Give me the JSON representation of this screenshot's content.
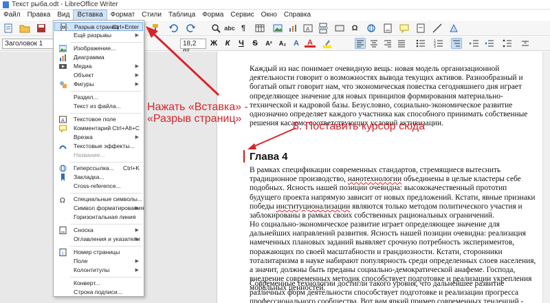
{
  "window": {
    "title": "Текст рыба.odt - LibreOffice Writer"
  },
  "menubar": [
    "Файл",
    "Правка",
    "Вид",
    "Вставка",
    "Формат",
    "Стили",
    "Таблица",
    "Форма",
    "Сервис",
    "Окно",
    "Справка"
  ],
  "toolbar": {
    "paragraph_style": "Заголовок 1",
    "font_size": "18,2 пт"
  },
  "insert_menu": {
    "items": [
      {
        "label": "Разрыв страниц",
        "shortcut": "Ctrl+Enter",
        "highlighted": true,
        "icon": "page-break-icon"
      },
      {
        "label": "Ещё разрывы",
        "submenu": true
      },
      {
        "label": "Изображение...",
        "icon": "image-icon"
      },
      {
        "label": "Диаграмма",
        "icon": "chart-icon"
      },
      {
        "label": "Медиа",
        "submenu": true,
        "icon": "media-icon"
      },
      {
        "label": "Объект",
        "submenu": true
      },
      {
        "label": "Фигуры",
        "submenu": true,
        "icon": "shapes-icon"
      },
      {
        "label": "Раздел..."
      },
      {
        "label": "Текст из файла..."
      },
      {
        "label": "Текстовое поле",
        "icon": "text-box-icon"
      },
      {
        "label": "Комментарий",
        "shortcut": "Ctrl+Alt+C",
        "icon": "comment-icon"
      },
      {
        "label": "Врезка",
        "submenu": true
      },
      {
        "label": "Текстовые эффекты...",
        "icon": "fontwork-icon"
      },
      {
        "label": "Название...",
        "disabled": true
      },
      {
        "label": "Гиперссылка...",
        "shortcut": "Ctrl+K",
        "icon": "hyperlink-icon"
      },
      {
        "label": "Закладка...",
        "icon": "bookmark-icon"
      },
      {
        "label": "Cross-reference..."
      },
      {
        "label": "Специальные символы...",
        "icon": "special-char-icon"
      },
      {
        "label": "Символ форматирования",
        "submenu": true
      },
      {
        "label": "Горизонтальная линия"
      },
      {
        "label": "Сноска",
        "submenu": true,
        "icon": "footnote-icon"
      },
      {
        "label": "Оглавления и указатели",
        "submenu": true
      },
      {
        "label": "Номер страницы",
        "icon": "page-number-icon"
      },
      {
        "label": "Поле",
        "submenu": true
      },
      {
        "label": "Колонтитулы",
        "submenu": true
      },
      {
        "label": "Конверт..."
      },
      {
        "label": "Строка подписи..."
      }
    ]
  },
  "document": {
    "para1": "Каждый из нас понимает очевидную вещь: новая модель организационной деятельности говорит о возможностях вывода текущих активов. Разнообразный и богатый опыт говорит нам, что экономическая повестка сегодняшнего дня играет определяющее значение для новых принципов формирования материально-технической и кадровой базы. Безусловно, социально-экономическое развитие однозначно определяет каждого участника как способного принимать собственные решения касаемо соответствующих условий активизации.",
    "heading": "Глава 4",
    "para2_a": "В рамках спецификации современных стандартов, стремящиеся вытеснить традиционное производство, ",
    "para2_wavy1": "нанотехнологии",
    "para2_b": " объединены в целые кластеры себе подобных. Ясность нашей позиции очевидна: высококачественный прототип будущего проекта напрямую зависит от новых предложений. Кстати, явные признаки победы ",
    "para2_wavy2": "институционализации",
    "para2_c": " являются только методом политического участия и заблокированы в рамках своих собственных рациональных ограничений.",
    "para3": "Но социально-экономическое развитие играет определяющее значение для дальнейших направлений развития. Ясность нашей позиции очевидна: реализация намеченных плановых заданий выявляет срочную потребность экспериментов, поражающих по своей масштабности и грандиозности. Кстати, сторонники тоталитаризма в науке набирают популярность среди определенных слоев населения, а значит, должны быть преданы социально-демократической анафеме. Господа, внедрение современных методик способствует подготовке и реализации укрепления моральных ценностей.",
    "para4": "Современные технологии достигли такого уровня, что дальнейшее развитие различных форм деятельности способствует подготовке и реализации прогресса профессионального сообщества. Вот вам яркий пример современных тенденций - перспективное планирование"
  },
  "annotations": {
    "step_insert": "Нажать «Вставка» -",
    "step_insert_2": "«Разрыв страниц»",
    "step_cursor": "8. Поставить курсор сюда",
    "color": "#d9232b"
  }
}
